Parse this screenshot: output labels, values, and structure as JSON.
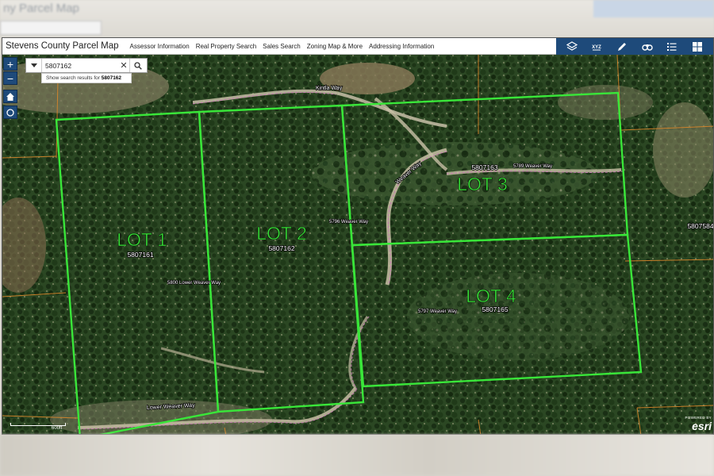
{
  "background": {
    "title_fragment": "ny Parcel Map"
  },
  "app": {
    "title": "Stevens County Parcel Map",
    "nav": [
      {
        "label": "Assessor Information"
      },
      {
        "label": "Real Property Search"
      },
      {
        "label": "Sales Search"
      },
      {
        "label": "Zoning Map & More"
      },
      {
        "label": "Addressing Information"
      }
    ],
    "tools": [
      "layers-icon",
      "xyz-icon",
      "measure-pencil-icon",
      "binoculars-icon",
      "legend-list-icon",
      "grid-apps-icon"
    ],
    "header_color": "#1e4a7a"
  },
  "search": {
    "value": "5807162",
    "suggest_prefix": "Show search results for",
    "suggest_value": "5807162"
  },
  "controls": {
    "zoom_in": "+",
    "zoom_out": "−"
  },
  "map": {
    "lot_color": "#39e639",
    "lots": [
      {
        "label": "LOT 1",
        "parcel": "5807161"
      },
      {
        "label": "LOT 2",
        "parcel": "5807162"
      },
      {
        "label": "LOT 3",
        "parcel": "5807163"
      },
      {
        "label": "LOT 4",
        "parcel": "5807165"
      }
    ],
    "addresses": [
      {
        "text": "5789 Weaver Way"
      },
      {
        "text": "5796 Weaver Way"
      },
      {
        "text": "5800 Lower Weaver Way"
      },
      {
        "text": "5797 Weaver Way"
      }
    ],
    "neighbor_parcel": "5807584",
    "roads": [
      {
        "name": "Kintla Way"
      },
      {
        "name": "Weaver Way"
      },
      {
        "name": "Lower Weaver Way"
      }
    ],
    "scale_label": "600ft",
    "attribution": {
      "powered": "POWERED BY",
      "brand": "esri"
    }
  }
}
